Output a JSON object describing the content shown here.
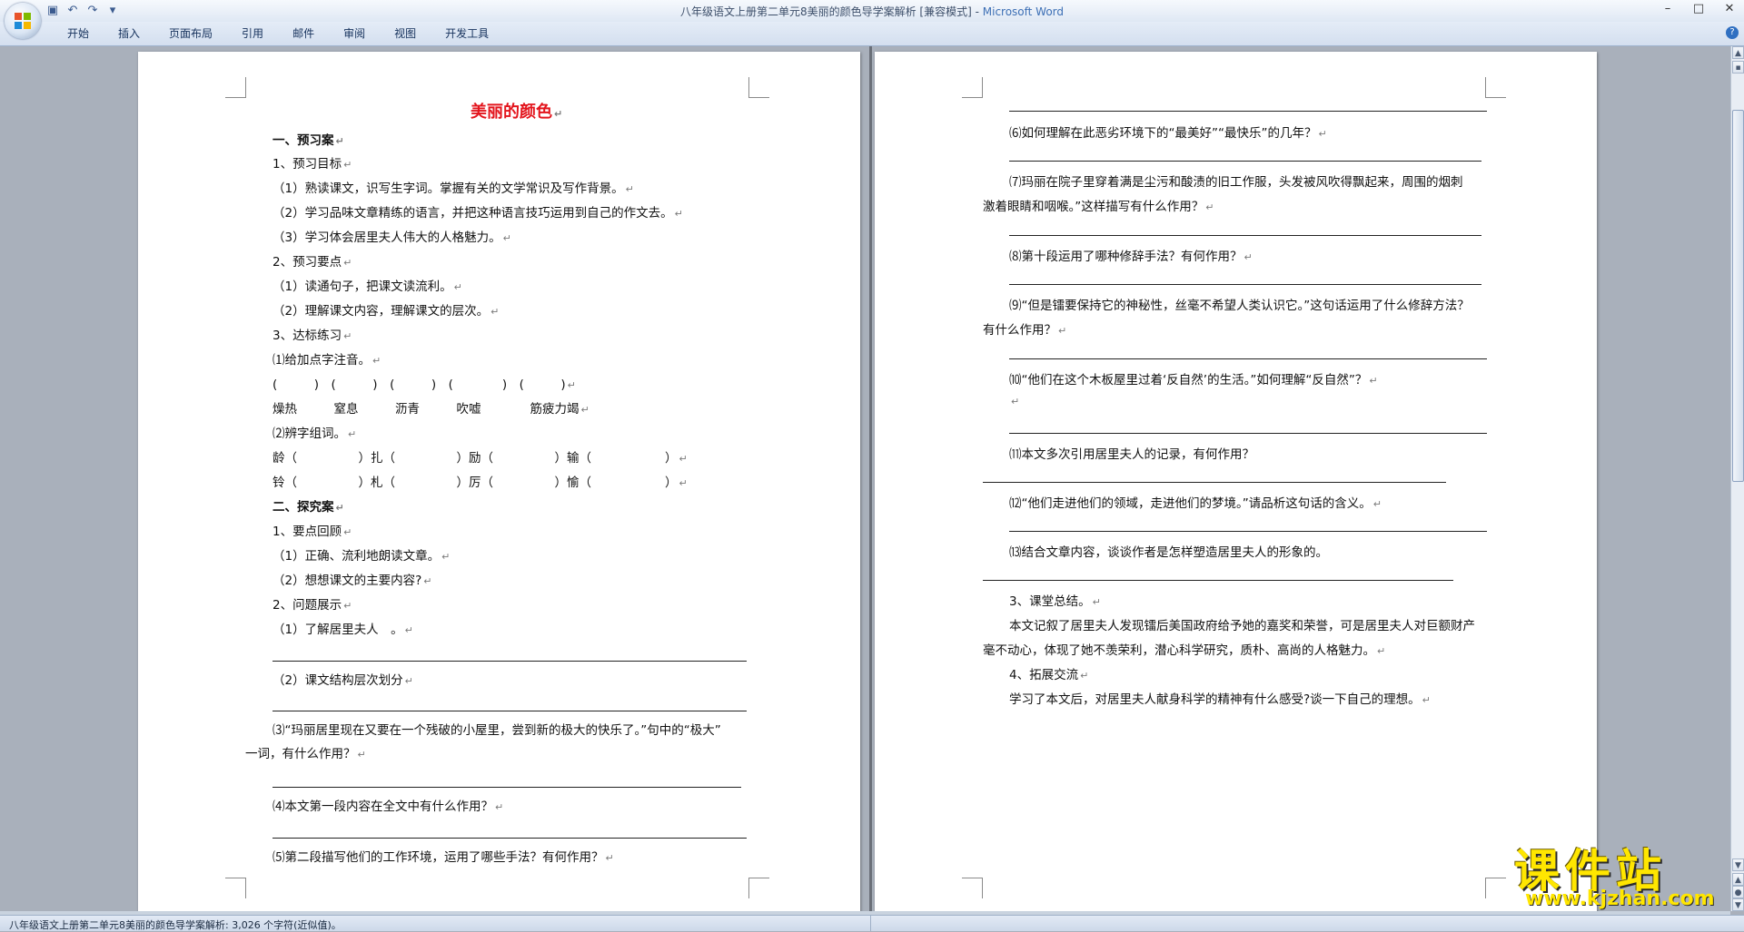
{
  "window": {
    "title": "八年级语文上册第二单元8美丽的颜色导学案解析 [兼容模式] - ",
    "app_name": "Microsoft Word",
    "controls": [
      "–",
      "□",
      "✕"
    ]
  },
  "quick_access": [
    "save-icon",
    "undo-icon",
    "redo-icon",
    "customize-icon"
  ],
  "ribbon": {
    "tabs": [
      "开始",
      "插入",
      "页面布局",
      "引用",
      "邮件",
      "审阅",
      "视图",
      "开发工具"
    ],
    "help_icon": "?"
  },
  "doc": {
    "page1": [
      "美丽的颜色",
      "一、预习案",
      "1、预习目标",
      "（1）熟读课文，识写生字词。掌握有关的文学常识及写作背景。",
      "（2）学习品味文章精练的语言，并把这种语言技巧运用到自己的作文去。",
      "（3）学习体会居里夫人伟大的人格魅力。",
      "2、预习要点",
      "（1）读通句子，把课文读流利。",
      "（2）理解课文内容，理解课文的层次。",
      "3、达标练习",
      "⑴给加点字注音。",
      "(　　　)　(　　　)　(　　　)　(　　　　)　(　　　)",
      "燥热　　　窒息　　　沥青　　　吹嘘　　　　筋疲力竭",
      "⑵辨字组词。",
      "龄（　　　　　）扎（　　　　　）励（　　　　　）输（　　　　　　）",
      "铃（　　　　　）札（　　　　　）厉（　　　　　）愉（　　　　　　）",
      "二、探究案",
      "1、要点回顾",
      "（1）正确、流利地朗读文章。",
      "（2）想想课文的主要内容?",
      "2、问题展示",
      "（1）了解居里夫人　。",
      "（2）课文结构层次划分",
      "⑶“玛丽居里现在又要在一个残破的小屋里，尝到新的极大的快乐了。”句中的“极大”",
      "一词，有什么作用？",
      "⑷本文第一段内容在全文中有什么作用？",
      "⑸第二段描写他们的工作环境，运用了哪些手法？有何作用？"
    ],
    "page2": [
      "⑹如何理解在此恶劣环境下的“最美好”“最快乐”的几年？",
      "⑺玛丽在院子里穿着满是尘污和酸渍的旧工作服，头发被风吹得飘起来，周围的烟刺",
      "激着眼睛和咽喉。”这样描写有什么作用？",
      "⑻第十段运用了哪种修辞手法？有何作用？",
      "⑼“但是镭要保持它的神秘性，丝毫不希望人类认识它。”这句话运用了什么修辞方法？",
      "有什么作用？",
      "⑽“他们在这个木板屋里过着‘反自然’的生活。”如何理解“反自然”？",
      "⑾本文多次引用居里夫人的记录，有何作用？",
      "⑿“他们走进他们的领域，走进他们的梦境。”请品析这句话的含义。",
      "⒀结合文章内容，谈谈作者是怎样塑造居里夫人的形象的。",
      "3、课堂总结。",
      "本文记叙了居里夫人发现镭后美国政府给予她的嘉奖和荣誉，可是居里夫人对巨额财产",
      "毫不动心，体现了她不羡荣利，潜心科学研究，质朴、高尚的人格魅力。",
      "4、拓展交流",
      "学习了本文后，对居里夫人献身科学的精神有什么感受?谈一下自己的理想。"
    ]
  },
  "statusbar": {
    "text": "八年级语文上册第二单元8美丽的颜色导学案解析: 3,026 个字符(近似值)。"
  },
  "watermark": {
    "main": "课件站",
    "url": "www.kjzhan.com"
  }
}
